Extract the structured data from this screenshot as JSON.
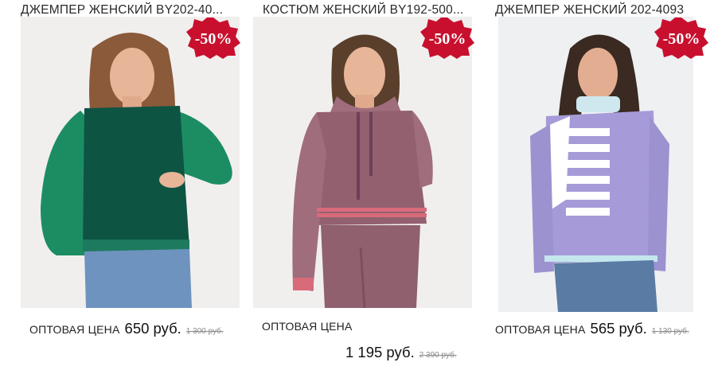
{
  "products": [
    {
      "title": "ДЖЕМПЕР ЖЕНСКИЙ BY202-40...",
      "badge": "-50%",
      "price_label": "ОПТОВАЯ ЦЕНА",
      "price": "650 руб.",
      "old_price": "1 300 руб.",
      "colors": {
        "top": "#1d7a5e",
        "body": "#0e5443",
        "sleeve": "#1c8d63",
        "jeans": "#6e93bf",
        "background": "#f1efee",
        "hair": "#8a5a3a",
        "skin": "#e7b598"
      }
    },
    {
      "title": "КОСТЮМ ЖЕНСКИЙ BY192-500...",
      "badge": "-50%",
      "price_label": "ОПТОВАЯ ЦЕНА",
      "price": "1 195 руб.",
      "old_price": "2 390 руб.",
      "colors": {
        "top": "#9a6675",
        "body": "#92606e",
        "sleeve": "#a06d7c",
        "jeans": "#90606e",
        "background": "#f1efee",
        "hair": "#5a3f2c",
        "skin": "#e7b598"
      }
    },
    {
      "title": "ДЖЕМПЕР ЖЕНСКИЙ 202-4093",
      "badge": "-50%",
      "price_label": "ОПТОВАЯ ЦЕНА",
      "price": "565 руб.",
      "old_price": "1 130 руб.",
      "colors": {
        "top": "#a59ad6",
        "body": "#a69bd8",
        "sleeve": "#9c92d0",
        "jeans": "#5a7ba4",
        "background": "#eef0f2",
        "hair": "#3a2a22",
        "skin": "#e2ad90"
      }
    }
  ],
  "badge_color": "#c8102e"
}
